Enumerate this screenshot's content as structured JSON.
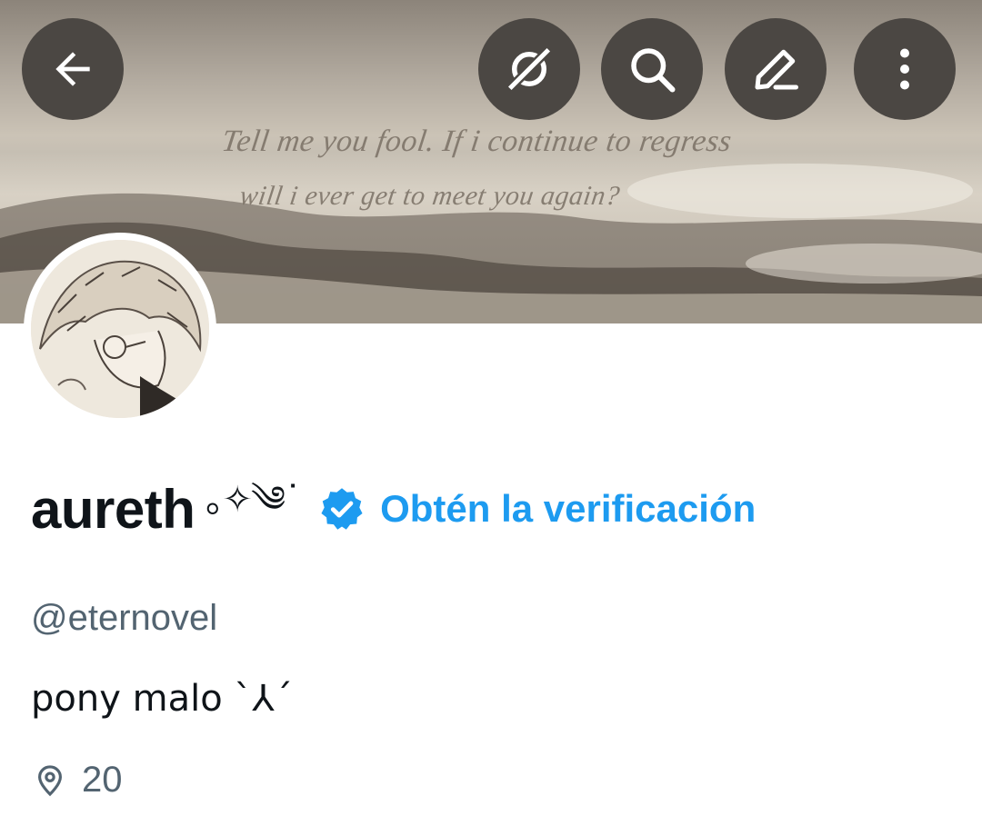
{
  "header": {
    "back_icon": "arrow-left-icon",
    "action_icons": [
      "grok-icon",
      "search-icon",
      "edit-icon",
      "more-vertical-icon"
    ],
    "banner_quote_line1": "Tell me you fool. If i continue to regress",
    "banner_quote_line2": "will i ever get to meet you again?"
  },
  "profile": {
    "display_name": "aureth",
    "name_decoration": "｡✧༄˙",
    "verified_icon": "verified-badge-icon",
    "get_verified_label": "Obtén la verificación",
    "handle": "@eternovel",
    "bio": "pony malo ˋ⅄ˊ",
    "location_icon": "location-pin-icon",
    "location": "20"
  },
  "colors": {
    "accent": "#1d9bf0",
    "text": "#0f1419",
    "secondary_text": "#536471",
    "top_button_bg": "#4b4743"
  }
}
